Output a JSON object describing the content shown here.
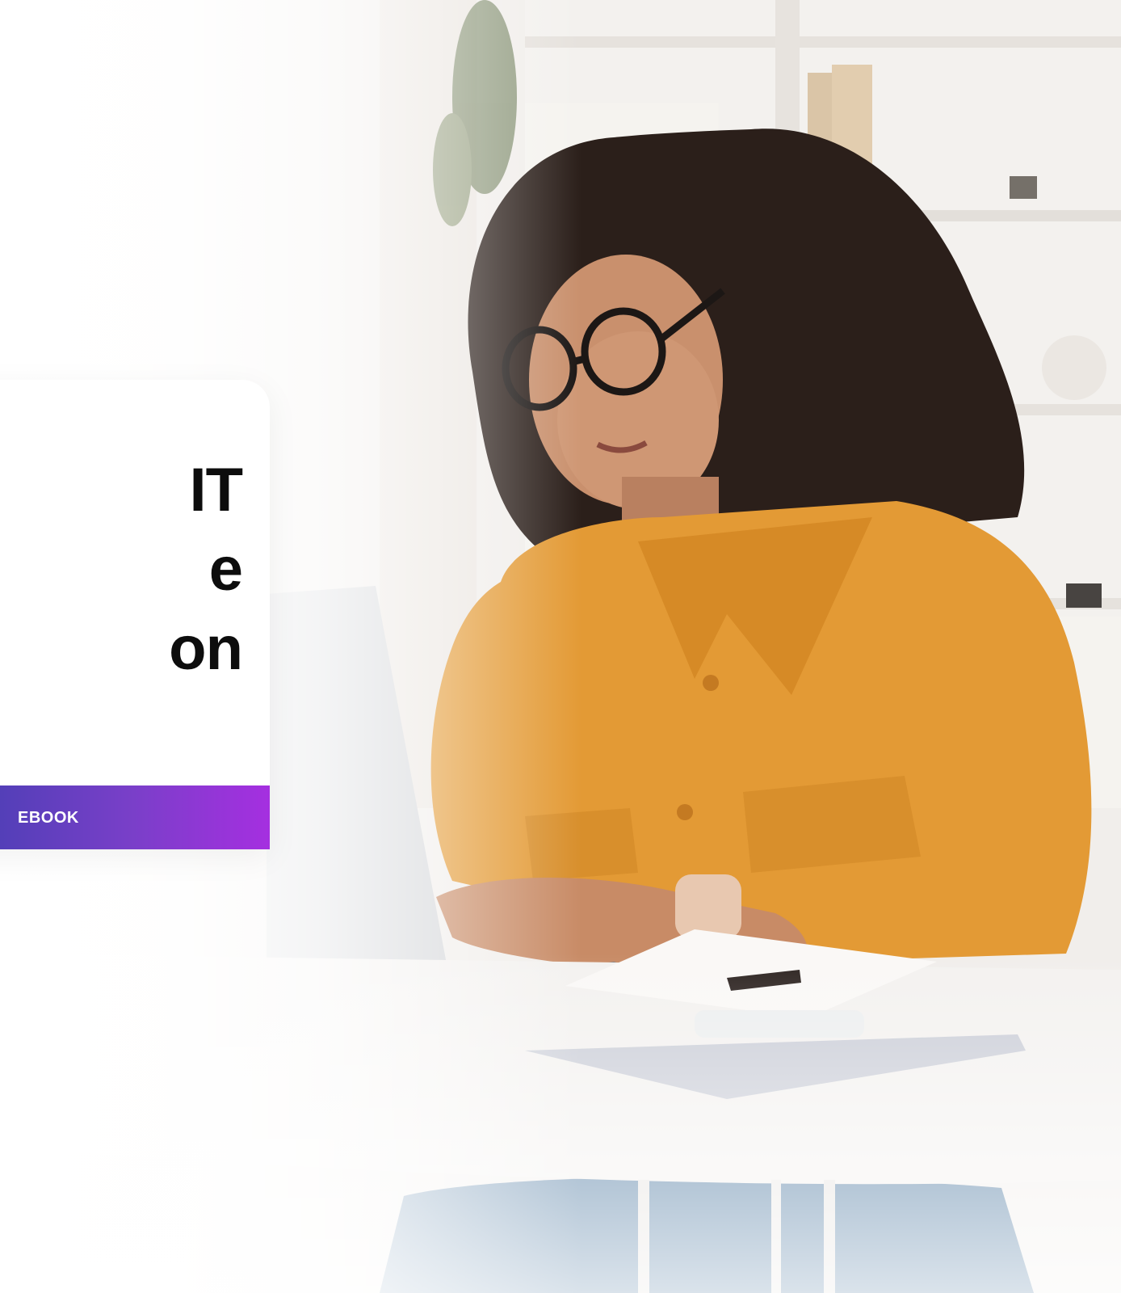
{
  "card": {
    "title_lines": [
      "IT",
      "e",
      "on"
    ],
    "label": "EBOOK"
  },
  "colors": {
    "band_start": "#4a3fb4",
    "band_end": "#a52fe0",
    "shirt": "#e39a35"
  }
}
